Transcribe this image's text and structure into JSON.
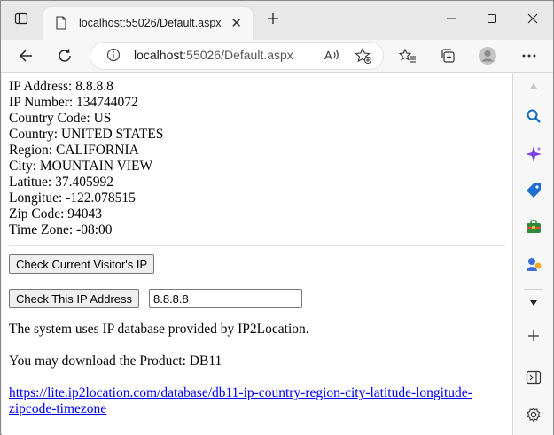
{
  "browser": {
    "tab_title": "localhost:55026/Default.aspx",
    "url_host": "localhost",
    "url_rest": ":55026/Default.aspx"
  },
  "info": {
    "ip_address": "IP Address: 8.8.8.8",
    "ip_number": "IP Number: 134744072",
    "country_code": "Country Code: US",
    "country": "Country: UNITED STATES",
    "region": "Region: CALIFORNIA",
    "city": "City: MOUNTAIN VIEW",
    "latitude": "Latitue: 37.405992",
    "longitude": "Longitue: -122.078515",
    "zip_code": "Zip Code: 94043",
    "time_zone": "Time Zone: -08:00"
  },
  "form": {
    "check_visitor_label": "Check Current Visitor's IP",
    "check_ip_label": "Check This IP Address",
    "ip_value": "8.8.8.8"
  },
  "footer": {
    "db_note": "The system uses IP database provided by IP2Location.",
    "product_note": "You may download the Product: DB11",
    "link_line1": "https://lite.ip2location.com/database/db11-ip-country-region-city-latitude-longitude-",
    "link_line2": "zipcode-timezone"
  },
  "colors": {
    "link": "#0000ee",
    "copilot_accent": "#7b3fe4",
    "search_accent": "#0f6cbd"
  }
}
